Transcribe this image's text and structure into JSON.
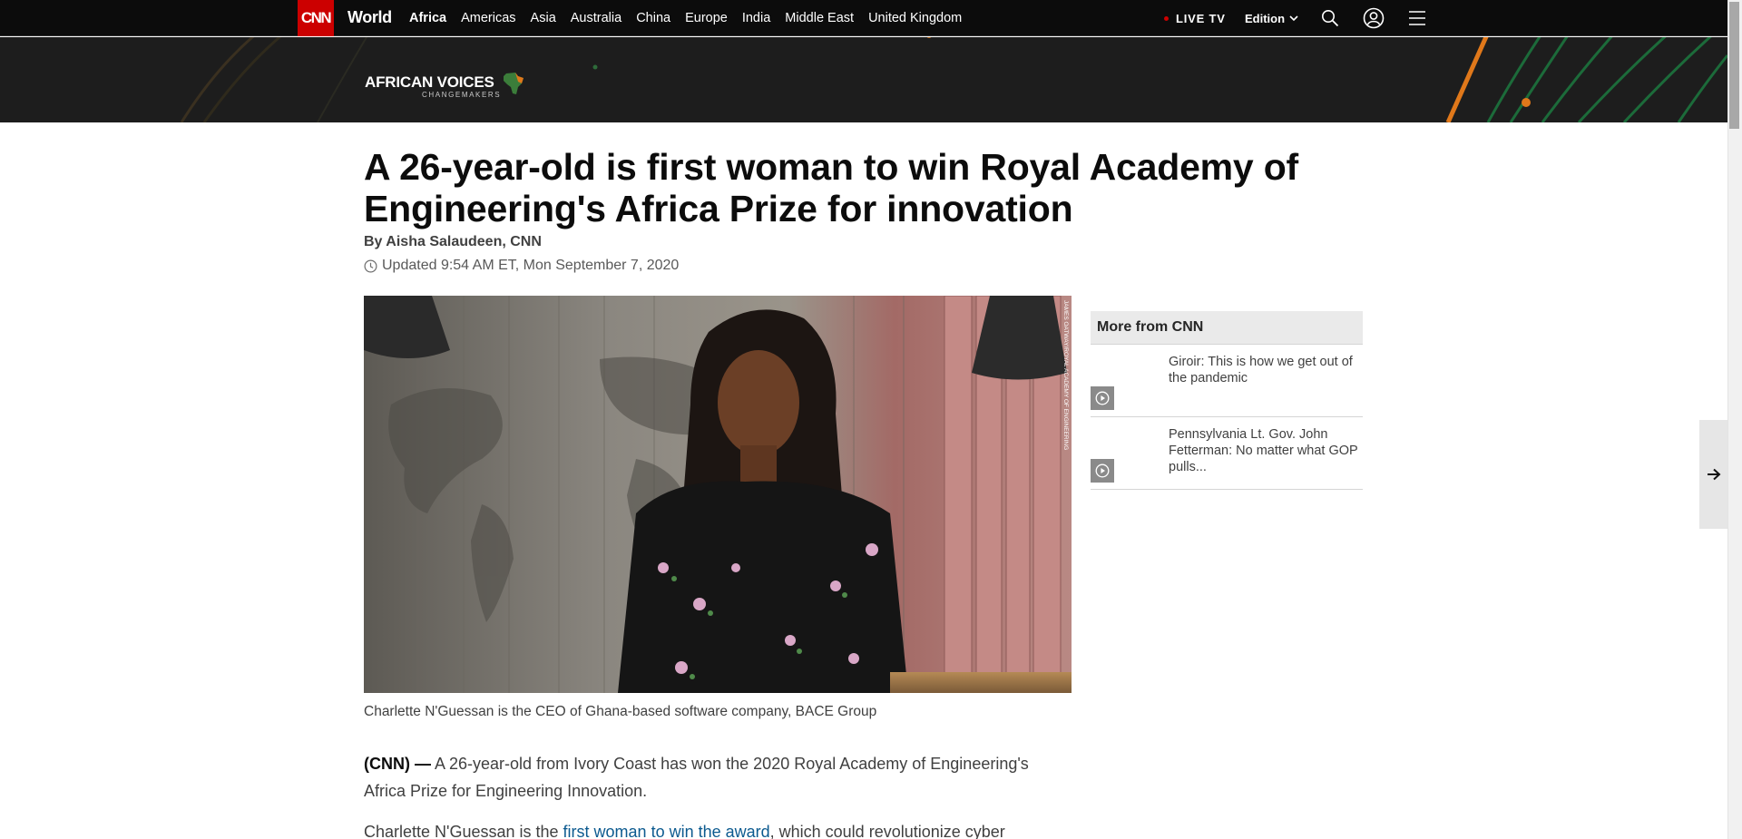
{
  "nav": {
    "logo": "CNN",
    "section": "World",
    "links": [
      "Africa",
      "Americas",
      "Asia",
      "Australia",
      "China",
      "Europe",
      "India",
      "Middle East",
      "United Kingdom"
    ],
    "active_link": "Africa",
    "live_tv": "LIVE TV",
    "edition": "Edition"
  },
  "banner": {
    "title": "AFRICAN VOICES",
    "subtitle": "CHANGEMAKERS"
  },
  "article": {
    "headline": "A 26-year-old is first woman to win Royal Academy of Engineering's Africa Prize for innovation",
    "byline": "By Aisha Salaudeen, CNN",
    "updated": "Updated 9:54 AM ET, Mon September 7, 2020",
    "photo_credit": "JAMES OATWAY/ROYAL ACADEMY OF ENGINEERING",
    "caption": "Charlette N'Guessan is the CEO of Ghana-based software company, BACE Group",
    "para1_source": "(CNN) —",
    "para1_text": " A 26-year-old from Ivory Coast has won the 2020 Royal Academy of Engineering's Africa Prize for Engineering Innovation.",
    "para2_before": "Charlette N'Guessan is the ",
    "para2_link": "first woman to win the award",
    "para2_after": ", which could revolutionize cyber"
  },
  "sidebar": {
    "title": "More from CNN",
    "items": [
      {
        "text": "Giroir: This is how we get out of the pandemic"
      },
      {
        "text": "Pennsylvania Lt. Gov. John Fetterman: No matter what GOP pulls..."
      }
    ]
  },
  "colors": {
    "brand_red": "#cc0000",
    "nav_bg": "#0c0c0c",
    "link_blue": "#0c5a8f"
  }
}
